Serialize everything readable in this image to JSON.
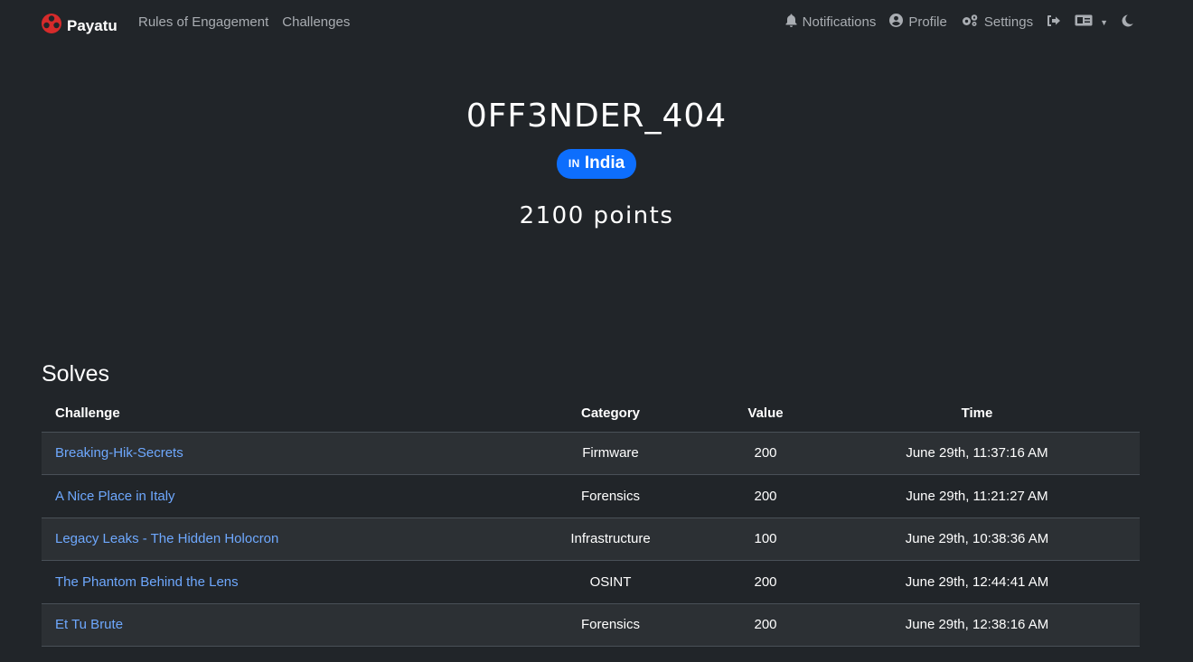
{
  "nav": {
    "brand": "Payatu",
    "left_links": [
      "Rules of Engagement",
      "Challenges"
    ],
    "notifications": "Notifications",
    "profile": "Profile",
    "settings": "Settings",
    "icons": {
      "logout": "logout-icon",
      "language": "language-icon",
      "theme": "moon-icon"
    }
  },
  "profile": {
    "username": "0FF3NDER_404",
    "country_code": "IN",
    "country": "India",
    "points": "2100 points"
  },
  "solves": {
    "title": "Solves",
    "headers": [
      "Challenge",
      "Category",
      "Value",
      "Time"
    ],
    "rows": [
      {
        "challenge": "Breaking-Hik-Secrets",
        "category": "Firmware",
        "value": "200",
        "time": "June 29th, 11:37:16 AM"
      },
      {
        "challenge": "A Nice Place in Italy",
        "category": "Forensics",
        "value": "200",
        "time": "June 29th, 11:21:27 AM"
      },
      {
        "challenge": "Legacy Leaks - The Hidden Holocron",
        "category": "Infrastructure",
        "value": "100",
        "time": "June 29th, 10:38:36 AM"
      },
      {
        "challenge": "The Phantom Behind the Lens",
        "category": "OSINT",
        "value": "200",
        "time": "June 29th, 12:44:41 AM"
      },
      {
        "challenge": "Et Tu Brute",
        "category": "Forensics",
        "value": "200",
        "time": "June 29th, 12:38:16 AM"
      }
    ]
  },
  "colors": {
    "background": "#212529",
    "link": "#6ea8fe",
    "badge": "#0d6efd",
    "stripe": "#2c3034"
  }
}
